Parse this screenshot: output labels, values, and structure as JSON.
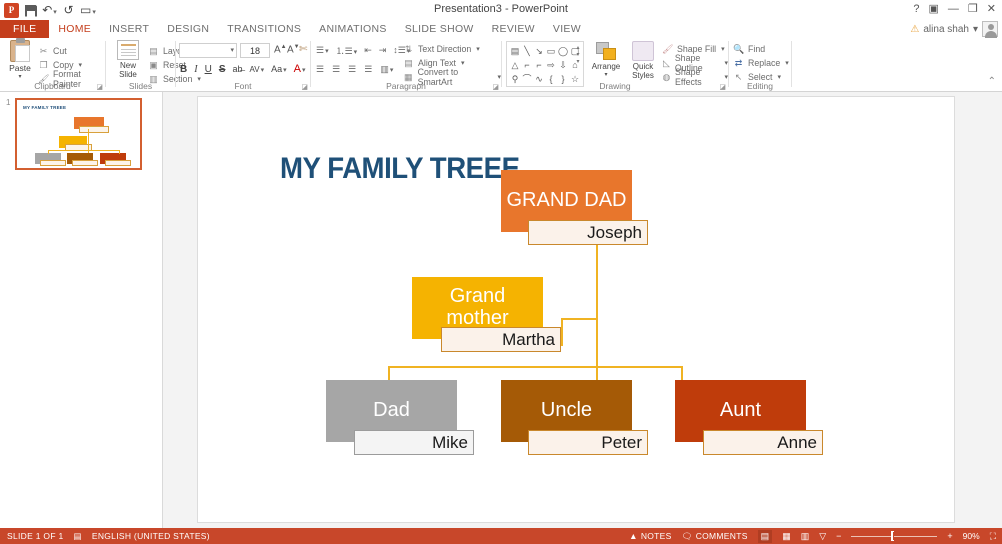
{
  "titlebar": {
    "app_logo": "powerpoint-logo",
    "title": "Presentation3 - PowerPoint",
    "quick_access": [
      {
        "name": "save-icon",
        "label": "Save"
      },
      {
        "name": "undo-icon",
        "label": "↶"
      },
      {
        "name": "redo-icon",
        "label": "↺"
      },
      {
        "name": "start-slideshow-icon",
        "label": "▭"
      }
    ],
    "window_controls": [
      {
        "name": "help-icon",
        "glyph": "?"
      },
      {
        "name": "ribbon-display-options-icon",
        "glyph": "▣"
      },
      {
        "name": "minimize-icon",
        "glyph": "—"
      },
      {
        "name": "restore-icon",
        "glyph": "❐"
      },
      {
        "name": "close-icon",
        "glyph": "✕"
      }
    ],
    "account_name": "alina shah",
    "account_caret": "▾"
  },
  "tabs": [
    {
      "label": "FILE",
      "state": "file"
    },
    {
      "label": "HOME",
      "state": "active"
    },
    {
      "label": "INSERT",
      "state": "normal"
    },
    {
      "label": "DESIGN",
      "state": "normal"
    },
    {
      "label": "TRANSITIONS",
      "state": "normal"
    },
    {
      "label": "ANIMATIONS",
      "state": "normal"
    },
    {
      "label": "SLIDE SHOW",
      "state": "normal"
    },
    {
      "label": "REVIEW",
      "state": "normal"
    },
    {
      "label": "VIEW",
      "state": "normal"
    }
  ],
  "ribbon": {
    "clipboard": {
      "group_label": "Clipboard",
      "paste_label": "Paste",
      "items": [
        {
          "label": "Cut",
          "icon": "scissors-icon"
        },
        {
          "label": "Copy",
          "icon": "copy-icon"
        },
        {
          "label": "Format Painter",
          "icon": "format-painter-icon"
        }
      ]
    },
    "slides": {
      "group_label": "Slides",
      "new_slide_label": "New Slide",
      "items": [
        {
          "label": "Layout",
          "icon": "layout-icon"
        },
        {
          "label": "Reset",
          "icon": "reset-icon"
        },
        {
          "label": "Section",
          "icon": "section-icon"
        }
      ]
    },
    "font": {
      "group_label": "Font",
      "font_name": "",
      "font_size": "18",
      "buttons": [
        "A↑",
        "A↓",
        "✄",
        "B",
        "I",
        "U",
        "S",
        "ab",
        "AV",
        "Aa",
        "A"
      ]
    },
    "paragraph": {
      "group_label": "Paragraph",
      "items": [
        {
          "label": "Text Direction",
          "icon": "text-direction-icon"
        },
        {
          "label": "Align Text",
          "icon": "align-text-icon"
        },
        {
          "label": "Convert to SmartArt",
          "icon": "smartart-icon"
        }
      ]
    },
    "drawing": {
      "group_label": "Drawing",
      "arrange_label": "Arrange",
      "quick_styles_label": "Quick Styles",
      "items": [
        {
          "label": "Shape Fill",
          "icon": "shape-fill-icon"
        },
        {
          "label": "Shape Outline",
          "icon": "shape-outline-icon"
        },
        {
          "label": "Shape Effects",
          "icon": "shape-effects-icon"
        }
      ],
      "shapes": [
        "▭",
        "╲",
        "↘",
        "▭",
        "◯",
        "▢",
        "△",
        "⌐",
        "⌐",
        "⇨",
        "⇩",
        "⌂",
        "⚲",
        "⌒",
        "∿",
        "{",
        "}",
        "☆"
      ]
    },
    "editing": {
      "group_label": "Editing",
      "items": [
        {
          "label": "Find",
          "icon": "binoculars-icon"
        },
        {
          "label": "Replace",
          "icon": "replace-icon"
        },
        {
          "label": "Select",
          "icon": "select-icon"
        }
      ]
    },
    "collapse_icon": "collapse-ribbon-icon"
  },
  "sidebar": {
    "slide_number": "1",
    "thumb_title": "MY FAMILY TREEE"
  },
  "slide": {
    "title": "MY FAMILY TREEE",
    "nodes": [
      {
        "id": "grand-dad",
        "role": "GRAND DAD",
        "person": "Joseph",
        "color": "#e8762c"
      },
      {
        "id": "grand-mother",
        "role": "Grand mother",
        "person": "Martha",
        "color": "#f5b301"
      },
      {
        "id": "dad",
        "role": "Dad",
        "person": "Mike",
        "color": "#a6a6a6"
      },
      {
        "id": "uncle",
        "role": "Uncle",
        "person": "Peter",
        "color": "#a55a06"
      },
      {
        "id": "aunt",
        "role": "Aunt",
        "person": "Anne",
        "color": "#bf3c0b"
      }
    ],
    "connector_color": "#f0b323",
    "title_color": "#1f5078"
  },
  "statusbar": {
    "slide_indicator": "SLIDE 1 OF 1",
    "language": "ENGLISH (UNITED STATES)",
    "notes_label": "NOTES",
    "comments_label": "COMMENTS",
    "views": [
      {
        "name": "normal-view-icon",
        "glyph": "▤",
        "active": true
      },
      {
        "name": "slide-sorter-icon",
        "glyph": "▦",
        "active": false
      },
      {
        "name": "reading-view-icon",
        "glyph": "▥",
        "active": false
      },
      {
        "name": "slideshow-icon",
        "glyph": "▽",
        "active": false
      }
    ],
    "zoom_out": "−",
    "zoom_in": "+",
    "zoom_level": "90%",
    "fit_icon": "fit-slide-icon"
  }
}
